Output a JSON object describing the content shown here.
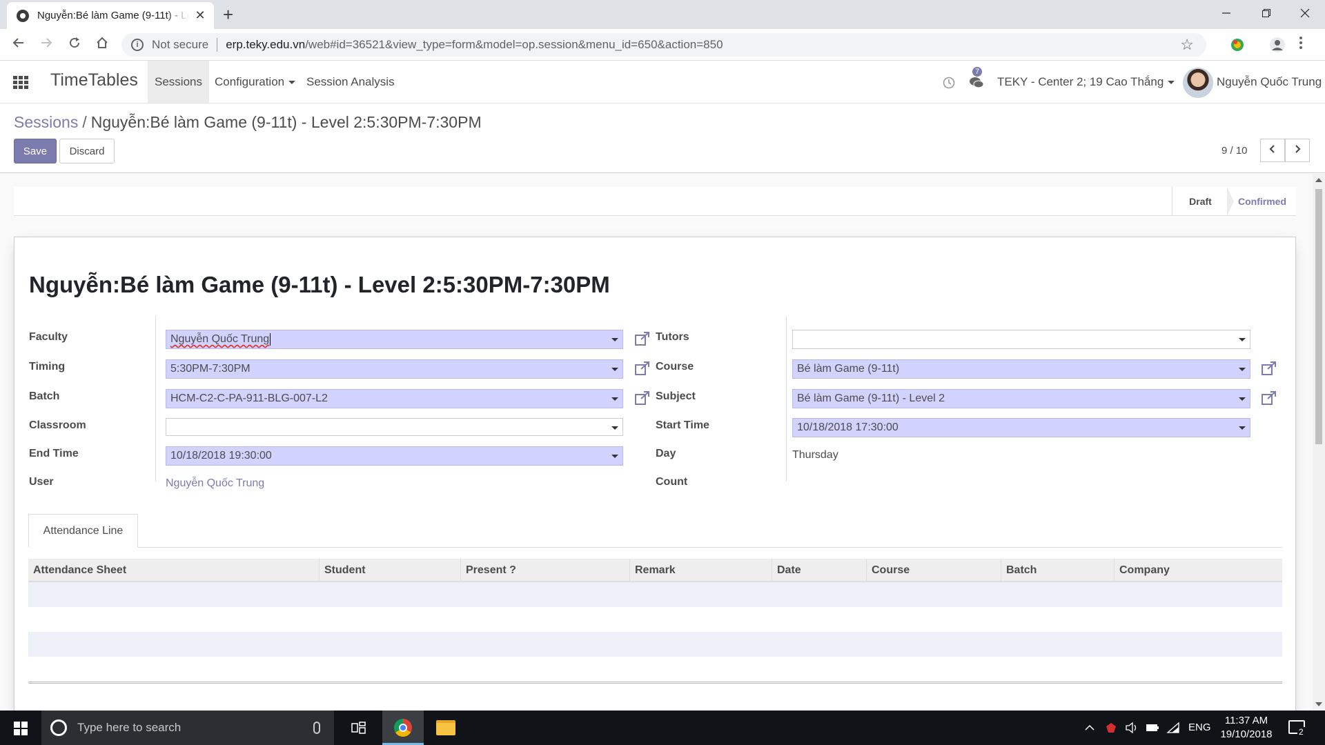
{
  "browser": {
    "tab_title": "Nguyễn:Bé làm Game (9-11t) - Level 2:5:30PM-7:30PM",
    "tab_close": "✕",
    "new_tab": "+",
    "security_label": "Not secure",
    "url_host": "erp.teky.edu.vn",
    "url_path": "/web#id=36521&view_type=form&model=op.session&menu_id=650&action=850",
    "icons": [
      "back-icon",
      "forward-icon",
      "reload-icon",
      "home-icon",
      "info-icon",
      "star-icon",
      "extension-icon",
      "profile-icon",
      "menu-icon"
    ]
  },
  "navbar": {
    "brand": "TimeTables",
    "menu": [
      "Sessions",
      "Configuration",
      "Session Analysis"
    ],
    "notification_count": "7",
    "company": "TEKY - Center 2; 19 Cao Thắng",
    "user": "Nguyễn Quốc Trung"
  },
  "control_panel": {
    "breadcrumb_parent": "Sessions",
    "breadcrumb_sep": "/",
    "breadcrumb_current": "Nguyễn:Bé làm Game (9-11t) - Level 2:5:30PM-7:30PM",
    "save_label": "Save",
    "discard_label": "Discard",
    "pager": "9 / 10"
  },
  "statusbar": {
    "stages": [
      "Draft",
      "Confirmed"
    ],
    "current": "Confirmed"
  },
  "form": {
    "title": "Nguyễn:Bé làm Game (9-11t) - Level 2:5:30PM-7:30PM",
    "left": {
      "faculty_label": "Faculty",
      "faculty_value": "Nguyễn Quốc Trung",
      "timing_label": "Timing",
      "timing_value": "5:30PM-7:30PM",
      "batch_label": "Batch",
      "batch_value": "HCM-C2-C-PA-911-BLG-007-L2",
      "classroom_label": "Classroom",
      "classroom_value": "",
      "end_time_label": "End Time",
      "end_time_value": "10/18/2018 19:30:00",
      "user_label": "User",
      "user_value": "Nguyễn Quốc Trung"
    },
    "right": {
      "tutors_label": "Tutors",
      "tutors_value": "",
      "course_label": "Course",
      "course_value": "Bé làm Game (9-11t)",
      "subject_label": "Subject",
      "subject_value": "Bé làm Game (9-11t) - Level 2",
      "start_time_label": "Start Time",
      "start_time_value": "10/18/2018 17:30:00",
      "day_label": "Day",
      "day_value": "Thursday",
      "count_label": "Count",
      "count_value": ""
    },
    "notebook_tab": "Attendance Line",
    "table_columns": [
      "Attendance Sheet",
      "Student",
      "Present ?",
      "Remark",
      "Date",
      "Course",
      "Batch",
      "Company"
    ]
  },
  "taskbar": {
    "search_placeholder": "Type here to search",
    "language": "ENG",
    "time": "11:37 AM",
    "date": "19/10/2018",
    "notifications": "2"
  },
  "colors": {
    "odoo_primary": "#7c7bad",
    "required_field": "#d2d2ff",
    "taskbar": "#101418"
  }
}
